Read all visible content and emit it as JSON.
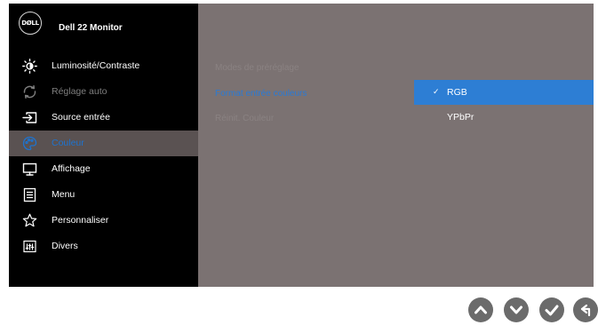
{
  "brand": {
    "logo_text": "DØLL",
    "model": "Dell 22 Monitor"
  },
  "menu": [
    {
      "label": "Luminosité/Contraste",
      "icon": "brightness-icon",
      "state": "normal"
    },
    {
      "label": "Réglage auto",
      "icon": "auto-adjust-icon",
      "state": "disabled"
    },
    {
      "label": "Source entrée",
      "icon": "input-source-icon",
      "state": "normal"
    },
    {
      "label": "Couleur",
      "icon": "color-palette-icon",
      "state": "selected"
    },
    {
      "label": "Affichage",
      "icon": "display-monitor-icon",
      "state": "normal"
    },
    {
      "label": "Menu",
      "icon": "menu-list-icon",
      "state": "normal"
    },
    {
      "label": "Personnaliser",
      "icon": "star-icon",
      "state": "normal"
    },
    {
      "label": "Divers",
      "icon": "others-icon",
      "state": "normal"
    }
  ],
  "options": [
    {
      "label": "Modes de préréglage",
      "state": "normal"
    },
    {
      "label": "Format entrée couleurs",
      "state": "active"
    },
    {
      "label": "Réinit. Couleur",
      "state": "normal"
    }
  ],
  "submenu": [
    {
      "label": "RGB",
      "check": "✓",
      "selected": true
    },
    {
      "label": "YPbPr",
      "check": "",
      "selected": false
    }
  ],
  "controls": [
    {
      "name": "up-button",
      "icon": "chevron-up-icon"
    },
    {
      "name": "down-button",
      "icon": "chevron-down-icon"
    },
    {
      "name": "ok-button",
      "icon": "checkmark-icon"
    },
    {
      "name": "back-button",
      "icon": "back-arrow-icon"
    }
  ],
  "colors": {
    "sidebar_bg": "#000000",
    "panel_bg": "#7b7272",
    "selected_menu_bg": "#5a5252",
    "accent": "#2d7ed4",
    "control_button": "#6b6b6b"
  }
}
